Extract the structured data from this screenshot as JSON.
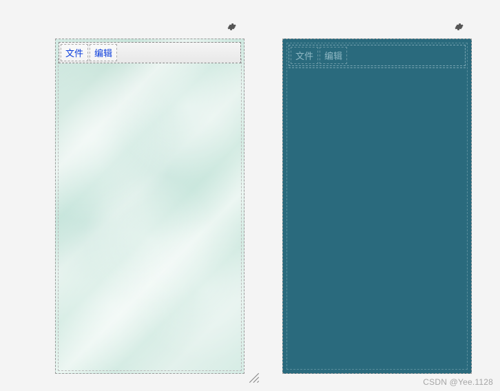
{
  "left_panel": {
    "menu": {
      "file": "文件",
      "edit": "编辑"
    }
  },
  "right_panel": {
    "menu": {
      "file": "文件",
      "edit": "编辑"
    }
  },
  "icons": {
    "gear": "gear-icon",
    "resize": "resize-grip-icon"
  },
  "watermark": "CSDN @Yee.1128"
}
